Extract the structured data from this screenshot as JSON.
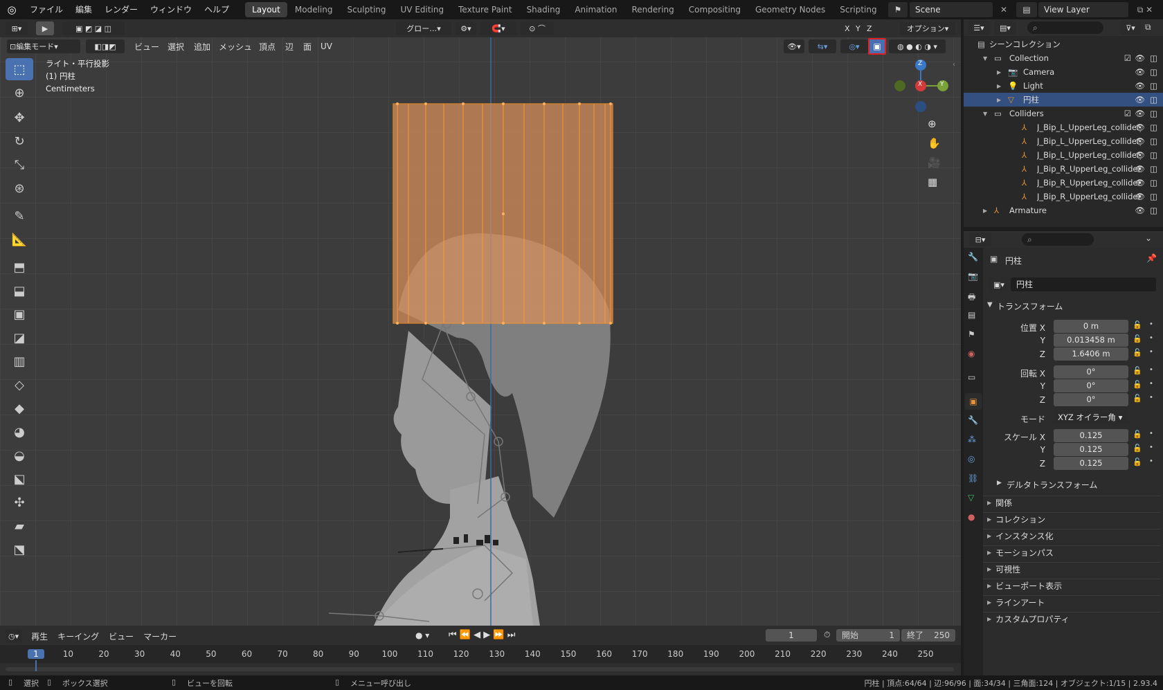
{
  "menu": [
    "ファイル",
    "編集",
    "レンダー",
    "ウィンドウ",
    "ヘルプ"
  ],
  "workspaces": [
    "Layout",
    "Modeling",
    "Sculpting",
    "UV Editing",
    "Texture Paint",
    "Shading",
    "Animation",
    "Rendering",
    "Compositing",
    "Geometry Nodes",
    "Scripting"
  ],
  "scene": "Scene",
  "view_layer": "View Layer",
  "header1": {
    "transform_orient": "グロー…",
    "options": "オプション",
    "axes": [
      "X",
      "Y",
      "Z"
    ]
  },
  "header2": {
    "mode": "編集モード",
    "items": [
      "ビュー",
      "選択",
      "追加",
      "メッシュ",
      "頂点",
      "辺",
      "面",
      "UV"
    ]
  },
  "overlay_text": {
    "line1": "ライト・平行投影",
    "line2": "(1) 円柱",
    "line3": "Centimeters"
  },
  "gizmo": {
    "z": "Z",
    "x": "X",
    "y": "Y"
  },
  "outliner": {
    "root": "シーンコレクション",
    "rows": [
      {
        "name": "Collection",
        "indent": 1
      },
      {
        "name": "Camera",
        "indent": 2
      },
      {
        "name": "Light",
        "indent": 2
      },
      {
        "name": "円柱",
        "indent": 2
      },
      {
        "name": "Colliders",
        "indent": 1
      },
      {
        "name": "J_Bip_L_UpperLeg_collider_(",
        "indent": 3
      },
      {
        "name": "J_Bip_L_UpperLeg_collider_",
        "indent": 3
      },
      {
        "name": "J_Bip_L_UpperLeg_collider_",
        "indent": 3
      },
      {
        "name": "J_Bip_R_UpperLeg_collider_",
        "indent": 3
      },
      {
        "name": "J_Bip_R_UpperLeg_collider_",
        "indent": 3
      },
      {
        "name": "J_Bip_R_UpperLeg_collider_",
        "indent": 3
      },
      {
        "name": "Armature",
        "indent": 1
      }
    ]
  },
  "properties": {
    "object_name": "円柱",
    "name_field": "円柱",
    "transform_title": "トランスフォーム",
    "location_label": "位置 X",
    "loc": [
      "0 m",
      "0.013458 m",
      "1.6406 m"
    ],
    "rotation_label": "回転 X",
    "rot": [
      "0°",
      "0°",
      "0°"
    ],
    "mode_label": "モード",
    "mode_value": "XYZ オイラー角",
    "scale_label": "スケール X",
    "scale": [
      "0.125",
      "0.125",
      "0.125"
    ],
    "y": "Y",
    "z": "Z",
    "delta": "デルタトランスフォーム",
    "sections": [
      "関係",
      "コレクション",
      "インスタンス化",
      "モーションパス",
      "可視性",
      "ビューポート表示",
      "ラインアート",
      "カスタムプロパティ"
    ]
  },
  "timeline": {
    "menus": [
      "再生",
      "キーイング",
      "ビュー",
      "マーカー"
    ],
    "current": "1",
    "start_label": "開始",
    "start": "1",
    "end_label": "終了",
    "end": "250",
    "ticks": [
      "1",
      "10",
      "20",
      "30",
      "40",
      "50",
      "60",
      "70",
      "80",
      "90",
      "100",
      "110",
      "120",
      "130",
      "140",
      "150",
      "160",
      "170",
      "180",
      "190",
      "200",
      "210",
      "220",
      "230",
      "240",
      "250"
    ]
  },
  "statusbar": {
    "items": [
      "選択",
      "ボックス選択",
      "ビューを回転",
      "メニュー呼び出し"
    ],
    "stats": "円柱 | 頂点:64/64 | 辺:96/96 | 面:34/34 | 三角面:124 | オブジェクト:1/15 | 2.93.4"
  }
}
